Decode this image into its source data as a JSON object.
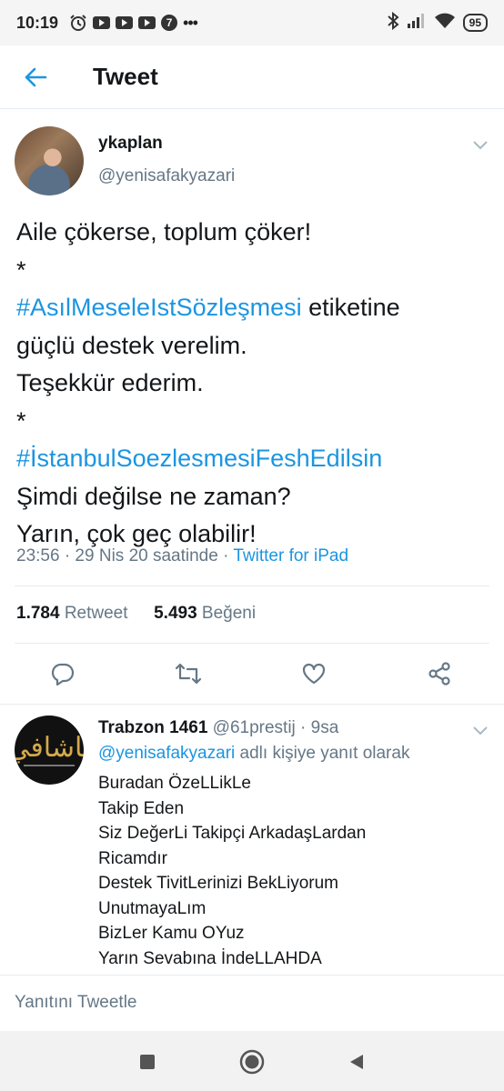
{
  "status_bar": {
    "time": "10:19",
    "icons": [
      "alarm-icon",
      "youtube-icon",
      "youtube-icon",
      "youtube-icon",
      "notification-7-icon",
      "more-dots-icon",
      "bluetooth-icon",
      "signal-icon",
      "wifi-icon"
    ],
    "notification_count": "7",
    "dots": "•••",
    "battery": "95"
  },
  "header": {
    "title": "Tweet"
  },
  "tweet": {
    "author_name": "ykaplan",
    "author_handle": "@yenisafakyazari",
    "lines": [
      {
        "text": "Aile çökerse, toplum çöker!"
      },
      {
        "text": "*"
      },
      {
        "hashtag": "#AsılMeseleIstSözleşmesi",
        "text": " etiketine"
      },
      {
        "text": "güçlü destek verelim."
      },
      {
        "text": "Teşekkür ederim."
      },
      {
        "text": "*"
      },
      {
        "hashtag": "#İstanbulSoezlesmesiFeshEdilsin"
      },
      {
        "text": "Şimdi değilse ne zaman?"
      },
      {
        "text": "Yarın, çok geç olabilir!"
      }
    ],
    "timestamp": "23:56 · 29 Nis 20 saatinde · ",
    "source": "Twitter for iPad",
    "retweet_count": "1.784",
    "retweet_label": "Retweet",
    "like_count": "5.493",
    "like_label": "Beğeni"
  },
  "reply": {
    "name": "Trabzon 1461",
    "handle": "@61prestij · 9sa",
    "reply_mention": "@yenisafakyazari",
    "reply_suffix": " adlı kişiye yanıt olarak",
    "avatar_text": "ياشافي",
    "lines": [
      "Buradan ÖzeLLikLe",
      "Takip Eden",
      "Siz DeğerLi Takipçi ArkadaşLardan",
      "Ricamdır",
      "Destek TivitLerinizi BekLiyorum",
      "UnutmayaLım",
      "BizLer Kamu OYuz",
      "Yarın Sevabına İndeLLAHDA"
    ]
  },
  "compose": {
    "placeholder": "Yanıtını Tweetle"
  },
  "colors": {
    "accent": "#1b95e0",
    "secondary_text": "#657786",
    "primary_text": "#14171a"
  }
}
